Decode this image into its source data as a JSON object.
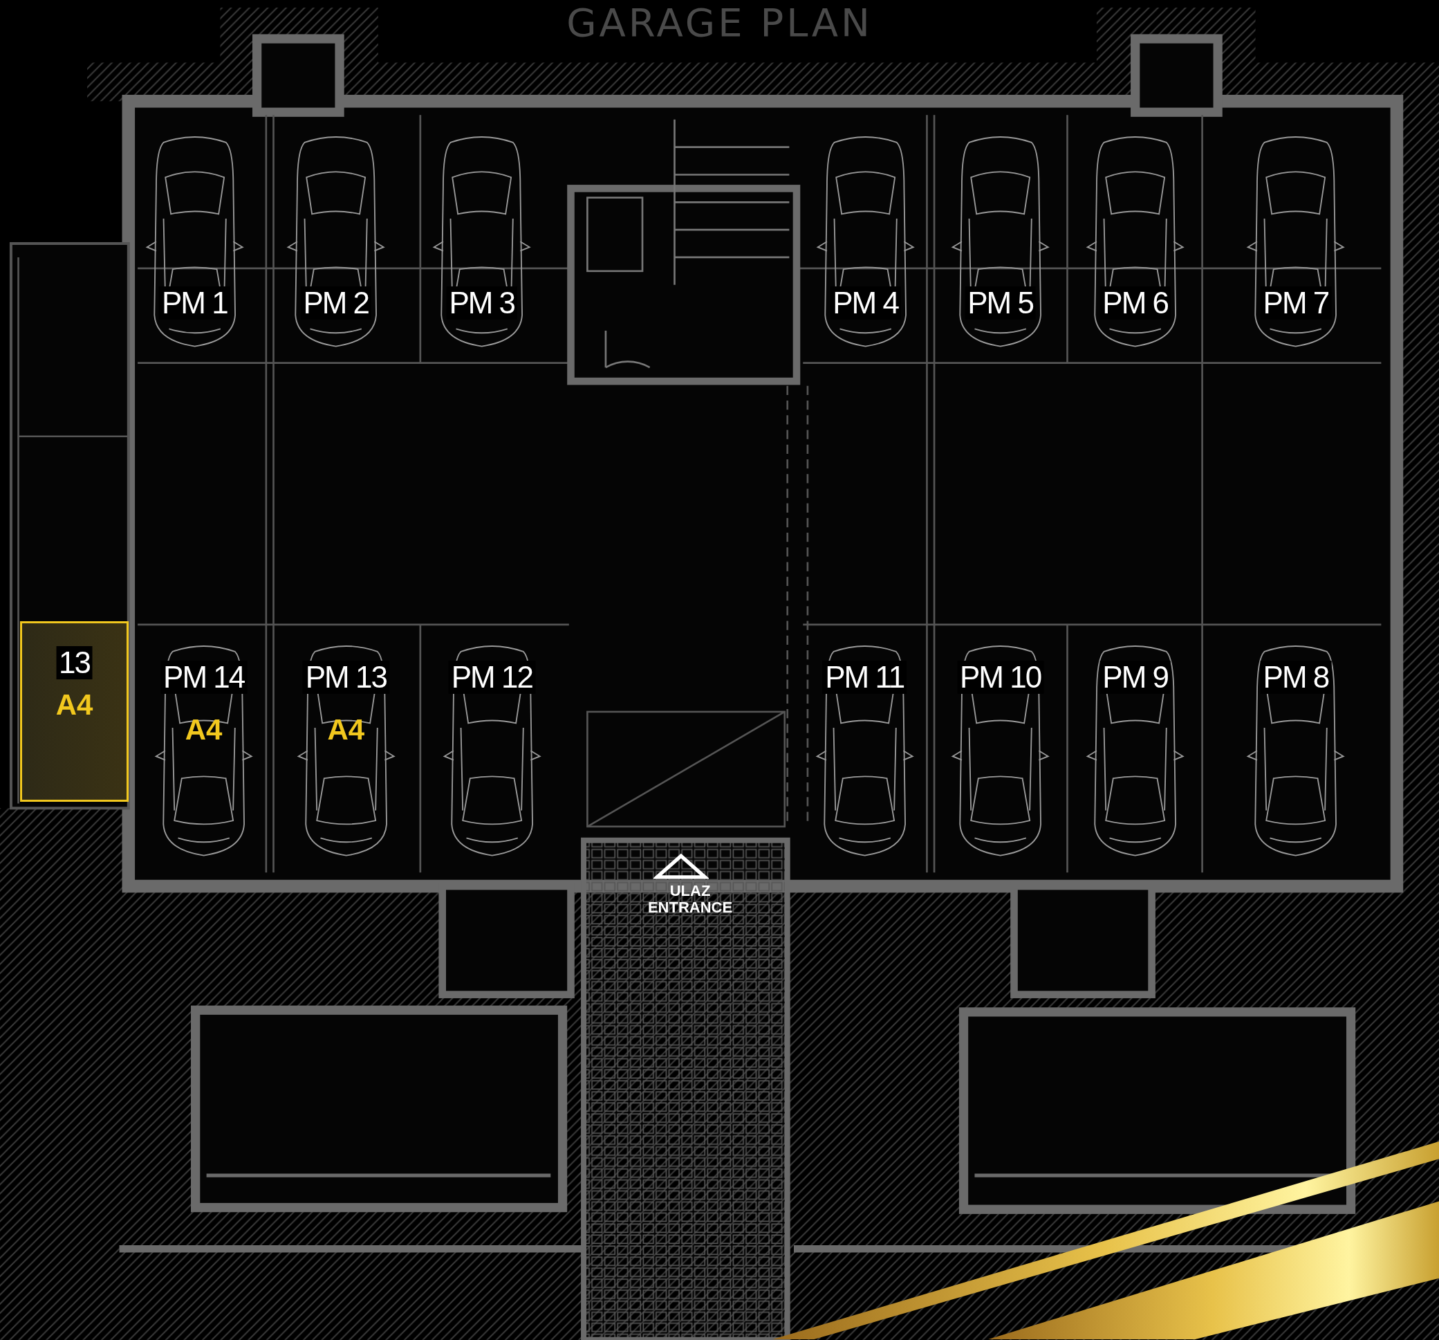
{
  "title": "GARAGE PLAN",
  "storage": {
    "number": "13",
    "tag": "A4",
    "selected": true
  },
  "top_row_spots": [
    {
      "label": "PM 1"
    },
    {
      "label": "PM 2"
    },
    {
      "label": "PM 3"
    },
    {
      "label": "PM 4"
    },
    {
      "label": "PM 5"
    },
    {
      "label": "PM 6"
    },
    {
      "label": "PM 7"
    }
  ],
  "bottom_row_spots": [
    {
      "label": "PM 14",
      "tag": "A4"
    },
    {
      "label": "PM 13",
      "tag": "A4"
    },
    {
      "label": "PM 12"
    },
    {
      "label": "PM 11"
    },
    {
      "label": "PM 10"
    },
    {
      "label": "PM 9"
    },
    {
      "label": "PM 8"
    }
  ],
  "entrance": {
    "label": "ULAZ",
    "sublabel": "ENTRANCE"
  }
}
